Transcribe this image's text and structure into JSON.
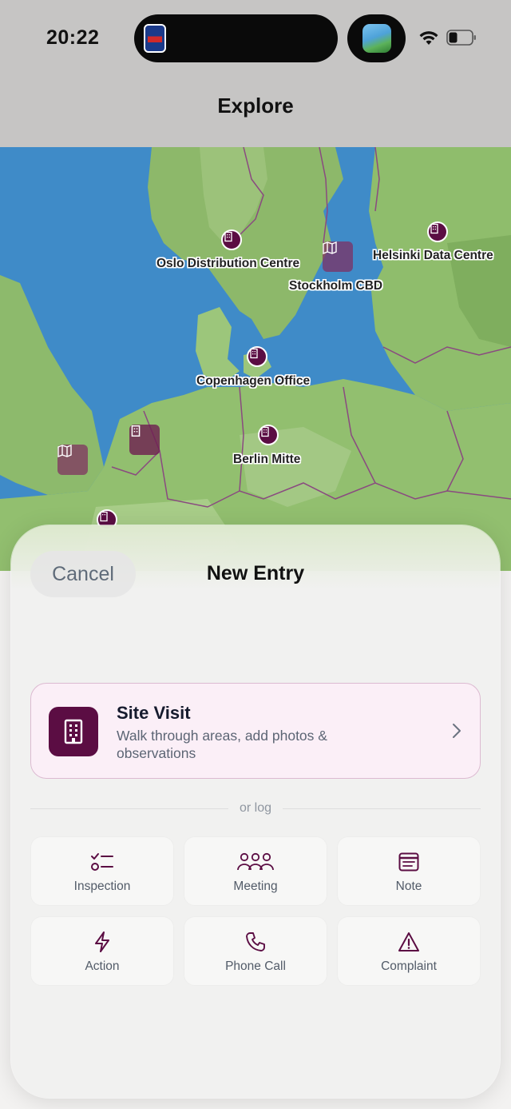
{
  "status_bar": {
    "time": "20:22",
    "wifi_icon": "wifi-icon",
    "battery_icon": "battery-low-icon"
  },
  "nav": {
    "title": "Explore"
  },
  "map": {
    "locations": [
      {
        "label": "Oslo Distribution Centre",
        "icon": "building-icon"
      },
      {
        "label": "Stockholm CBD",
        "icon": "map-icon"
      },
      {
        "label": "Helsinki Data Centre",
        "icon": "building-icon"
      },
      {
        "label": "Copenhagen Office",
        "icon": "building-icon"
      },
      {
        "label": "Berlin Mitte",
        "icon": "building-icon"
      }
    ],
    "extra_pins": [
      "map-icon",
      "building-icon",
      "building-icon"
    ]
  },
  "sheet": {
    "cancel_label": "Cancel",
    "title": "New Entry",
    "site_visit": {
      "title": "Site Visit",
      "description": "Walk through areas, add photos & observations",
      "icon": "building-icon"
    },
    "divider_label": "or log",
    "log_types": [
      {
        "label": "Inspection",
        "icon": "checklist-icon"
      },
      {
        "label": "Meeting",
        "icon": "people-icon"
      },
      {
        "label": "Note",
        "icon": "note-icon"
      },
      {
        "label": "Action",
        "icon": "lightning-icon"
      },
      {
        "label": "Phone Call",
        "icon": "phone-icon"
      },
      {
        "label": "Complaint",
        "icon": "warning-icon"
      }
    ]
  },
  "colors": {
    "accent": "#5b0d43",
    "site_visit_bg": "#fbeff7",
    "sheet_bg": "#f0f0ef"
  }
}
